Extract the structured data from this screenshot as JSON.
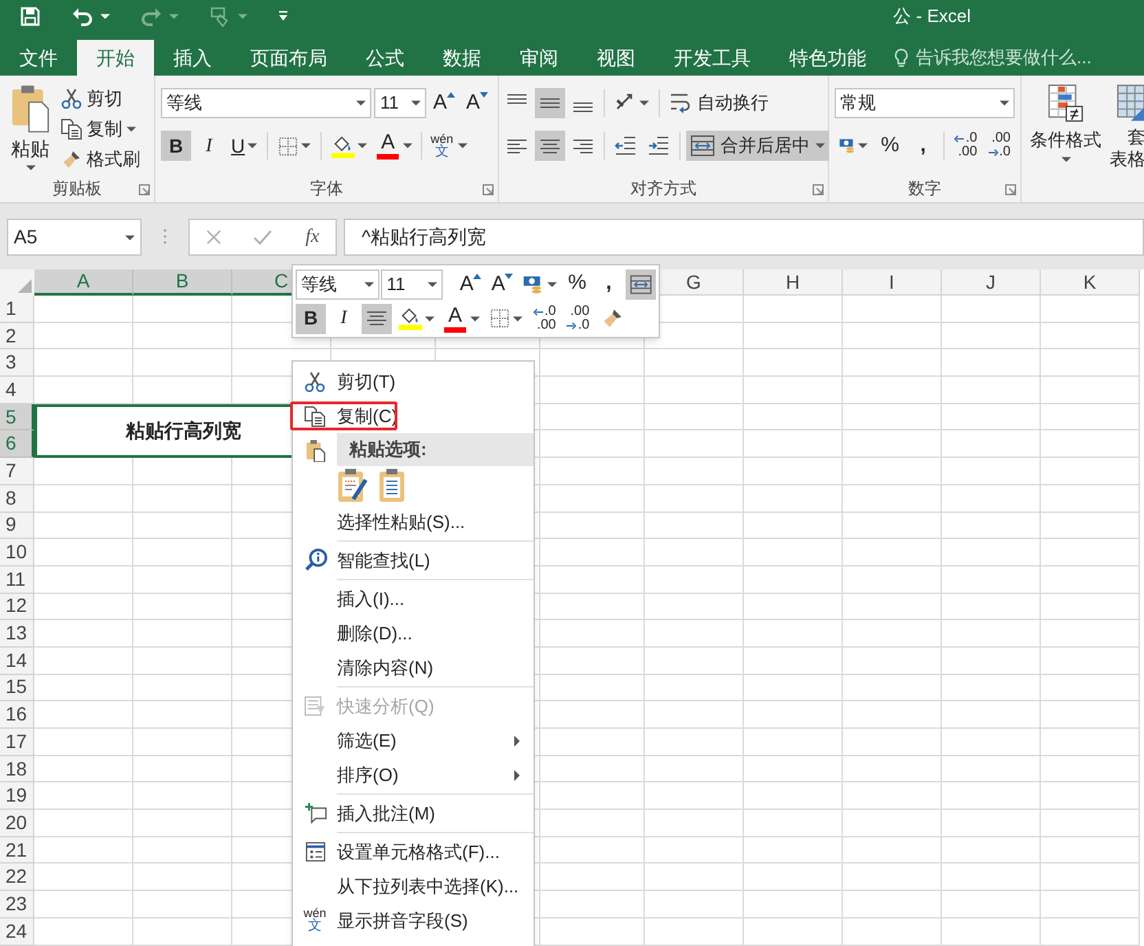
{
  "title_bar": {
    "title": "公 - Excel",
    "quick_access": [
      {
        "kind": "save",
        "disabled": false
      },
      {
        "kind": "undo",
        "disabled": false
      },
      {
        "kind": "redo",
        "disabled": true
      },
      {
        "kind": "touch",
        "disabled": true
      },
      {
        "kind": "customize",
        "disabled": false
      }
    ]
  },
  "tabs": [
    {
      "label": "文件",
      "selected": false
    },
    {
      "label": "开始",
      "selected": true
    },
    {
      "label": "插入",
      "selected": false
    },
    {
      "label": "页面布局",
      "selected": false
    },
    {
      "label": "公式",
      "selected": false
    },
    {
      "label": "数据",
      "selected": false
    },
    {
      "label": "审阅",
      "selected": false
    },
    {
      "label": "视图",
      "selected": false
    },
    {
      "label": "开发工具",
      "selected": false
    },
    {
      "label": "特色功能",
      "selected": false
    }
  ],
  "tell_me": "告诉我您想要做什么...",
  "ribbon": {
    "clipboard": {
      "paste": "粘贴",
      "cut": "剪切",
      "copy": "复制",
      "format_painter": "格式刷",
      "label": "剪贴板"
    },
    "font": {
      "font_name": "等线",
      "font_size": "11",
      "grow": "A",
      "shrink": "A",
      "styles": [
        {
          "label": "B",
          "selected": true
        },
        {
          "label": "I",
          "selected": false
        },
        {
          "label": "U",
          "selected": false
        }
      ],
      "font_color": "A",
      "phonetic": [
        "wén",
        "文"
      ],
      "label": "字体"
    },
    "alignment": {
      "vertical": [
        {
          "kind": "top",
          "selected": false
        },
        {
          "kind": "middle",
          "selected": true
        },
        {
          "kind": "bottom",
          "selected": false
        }
      ],
      "horizontal": [
        {
          "kind": "left",
          "selected": false
        },
        {
          "kind": "center",
          "selected": true
        },
        {
          "kind": "right",
          "selected": false
        }
      ],
      "wrap_text": {
        "label": "自动换行",
        "selected": false
      },
      "merge": {
        "label": "合并后居中",
        "selected": true
      },
      "label": "对齐方式"
    },
    "number": {
      "format": "常规",
      "percent": "%",
      "comma": ",",
      "increase_decimal": [
        ".0",
        ".00"
      ],
      "decrease_decimal": [
        ".00",
        ".0"
      ],
      "label": "数字"
    },
    "styles": {
      "conditional_formatting": "条件格式",
      "format_as_table": [
        "套",
        "表格"
      ]
    }
  },
  "formula_bar": {
    "name_box": "A5",
    "fx": "fx",
    "formula": "^粘贴行高列宽"
  },
  "sheet": {
    "columns": [
      {
        "label": "A",
        "selected": true
      },
      {
        "label": "B",
        "selected": true
      },
      {
        "label": "C",
        "selected": true
      },
      {
        "label": "G",
        "selected": false
      },
      {
        "label": "H",
        "selected": false
      },
      {
        "label": "I",
        "selected": false
      },
      {
        "label": "J",
        "selected": false
      },
      {
        "label": "K",
        "selected": false
      }
    ],
    "rows": [
      {
        "label": "1",
        "selected": false
      },
      {
        "label": "2",
        "selected": false
      },
      {
        "label": "3",
        "selected": false
      },
      {
        "label": "4",
        "selected": false
      },
      {
        "label": "5",
        "selected": true
      },
      {
        "label": "6",
        "selected": true
      },
      {
        "label": "7",
        "selected": false
      },
      {
        "label": "8",
        "selected": false
      },
      {
        "label": "9",
        "selected": false
      },
      {
        "label": "10",
        "selected": false
      },
      {
        "label": "11",
        "selected": false
      },
      {
        "label": "12",
        "selected": false
      },
      {
        "label": "13",
        "selected": false
      },
      {
        "label": "14",
        "selected": false
      },
      {
        "label": "15",
        "selected": false
      },
      {
        "label": "16",
        "selected": false
      },
      {
        "label": "17",
        "selected": false
      },
      {
        "label": "18",
        "selected": false
      },
      {
        "label": "19",
        "selected": false
      },
      {
        "label": "20",
        "selected": false
      },
      {
        "label": "21",
        "selected": false
      },
      {
        "label": "22",
        "selected": false
      },
      {
        "label": "23",
        "selected": false
      },
      {
        "label": "24",
        "selected": false
      }
    ],
    "merged_cell": "粘贴行高列宽"
  },
  "mini_toolbar": {
    "font_name": "等线",
    "font_size": "11",
    "grow": "A",
    "shrink": "A",
    "percent": "%",
    "comma": ",",
    "merge_selected": true,
    "styles": [
      {
        "label": "B",
        "selected": true
      },
      {
        "label": "I",
        "selected": false
      }
    ],
    "center_selected": true,
    "font_color": "A",
    "increase_decimal": [
      ".0",
      ".00"
    ],
    "decrease_decimal": [
      ".00",
      ".0"
    ]
  },
  "context_menu": {
    "items": [
      {
        "kind": "item",
        "label": "剪切(T)",
        "disabled": false,
        "submenu": false,
        "annotated": false
      },
      {
        "kind": "item",
        "label": "复制(C)",
        "disabled": false,
        "submenu": false,
        "annotated": true
      },
      {
        "kind": "header",
        "label": "粘贴选项:"
      },
      {
        "kind": "paste_options"
      },
      {
        "kind": "item",
        "label": "选择性粘贴(S)...",
        "disabled": false,
        "submenu": false,
        "annotated": false
      },
      {
        "kind": "separator"
      },
      {
        "kind": "item",
        "label": "智能查找(L)",
        "disabled": false,
        "submenu": false,
        "annotated": false
      },
      {
        "kind": "separator"
      },
      {
        "kind": "item",
        "label": "插入(I)...",
        "disabled": false,
        "submenu": false,
        "annotated": false
      },
      {
        "kind": "item",
        "label": "删除(D)...",
        "disabled": false,
        "submenu": false,
        "annotated": false
      },
      {
        "kind": "item",
        "label": "清除内容(N)",
        "disabled": false,
        "submenu": false,
        "annotated": false
      },
      {
        "kind": "separator"
      },
      {
        "kind": "item",
        "label": "快速分析(Q)",
        "disabled": true,
        "submenu": false,
        "annotated": false
      },
      {
        "kind": "item",
        "label": "筛选(E)",
        "disabled": false,
        "submenu": true,
        "annotated": false
      },
      {
        "kind": "item",
        "label": "排序(O)",
        "disabled": false,
        "submenu": true,
        "annotated": false
      },
      {
        "kind": "separator"
      },
      {
        "kind": "item",
        "label": "插入批注(M)",
        "disabled": false,
        "submenu": false,
        "annotated": false
      },
      {
        "kind": "separator"
      },
      {
        "kind": "item",
        "label": "设置单元格格式(F)...",
        "disabled": false,
        "submenu": false,
        "annotated": false
      },
      {
        "kind": "item",
        "label": "从下拉列表中选择(K)...",
        "disabled": false,
        "submenu": false,
        "annotated": false
      },
      {
        "kind": "item",
        "label": "显示拼音字段(S)",
        "disabled": false,
        "submenu": false,
        "annotated": false,
        "icon_text": [
          "wén",
          "文"
        ]
      }
    ]
  }
}
